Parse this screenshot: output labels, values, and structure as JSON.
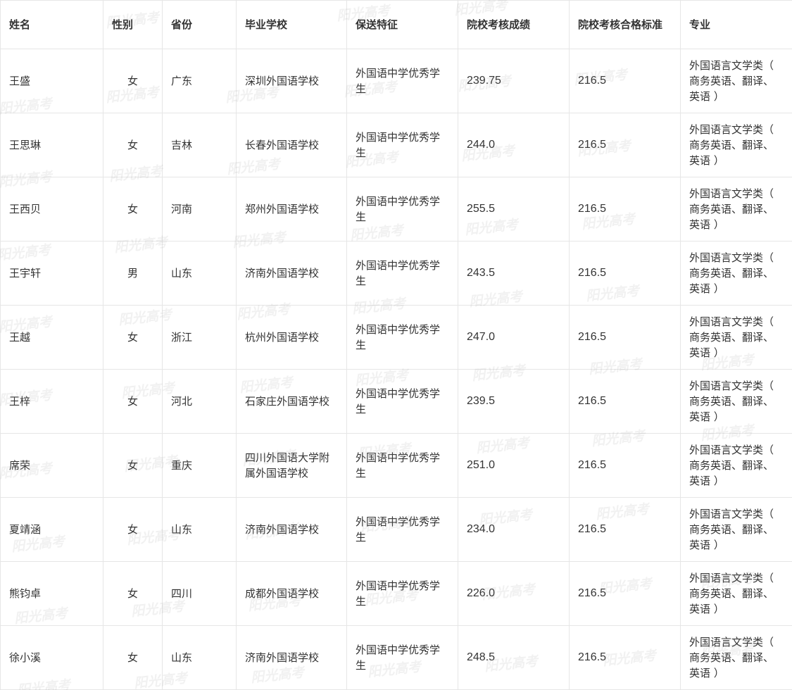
{
  "table": {
    "headers": [
      "姓名",
      "性别",
      "省份",
      "毕业学校",
      "保送特征",
      "院校考核成绩",
      "院校考核合格标准",
      "专业"
    ],
    "rows": [
      {
        "name": "王盛",
        "gender": "女",
        "province": "广东",
        "school": "深圳外国语学校",
        "feature": "外国语中学优秀学生",
        "score": "239.75",
        "standard": "216.5",
        "major": "外国语言文学类（ 商务英语、翻译、英语 ）"
      },
      {
        "name": "王思琳",
        "gender": "女",
        "province": "吉林",
        "school": "长春外国语学校",
        "feature": "外国语中学优秀学生",
        "score": "244.0",
        "standard": "216.5",
        "major": "外国语言文学类（ 商务英语、翻译、英语 ）"
      },
      {
        "name": "王西贝",
        "gender": "女",
        "province": "河南",
        "school": "郑州外国语学校",
        "feature": "外国语中学优秀学生",
        "score": "255.5",
        "standard": "216.5",
        "major": "外国语言文学类（ 商务英语、翻译、英语 ）"
      },
      {
        "name": "王宇轩",
        "gender": "男",
        "province": "山东",
        "school": "济南外国语学校",
        "feature": "外国语中学优秀学生",
        "score": "243.5",
        "standard": "216.5",
        "major": "外国语言文学类（ 商务英语、翻译、英语 ）"
      },
      {
        "name": "王越",
        "gender": "女",
        "province": "浙江",
        "school": "杭州外国语学校",
        "feature": "外国语中学优秀学生",
        "score": "247.0",
        "standard": "216.5",
        "major": "外国语言文学类（ 商务英语、翻译、英语 ）"
      },
      {
        "name": "王梓",
        "gender": "女",
        "province": "河北",
        "school": "石家庄外国语学校",
        "feature": "外国语中学优秀学生",
        "score": "239.5",
        "standard": "216.5",
        "major": "外国语言文学类（ 商务英语、翻译、英语 ）"
      },
      {
        "name": "席荣",
        "gender": "女",
        "province": "重庆",
        "school": "四川外国语大学附属外国语学校",
        "feature": "外国语中学优秀学生",
        "score": "251.0",
        "standard": "216.5",
        "major": "外国语言文学类（ 商务英语、翻译、英语 ）"
      },
      {
        "name": "夏靖涵",
        "gender": "女",
        "province": "山东",
        "school": "济南外国语学校",
        "feature": "外国语中学优秀学生",
        "score": "234.0",
        "standard": "216.5",
        "major": "外国语言文学类（ 商务英语、翻译、英语 ）"
      },
      {
        "name": "熊钧卓",
        "gender": "女",
        "province": "四川",
        "school": "成都外国语学校",
        "feature": "外国语中学优秀学生",
        "score": "226.0",
        "standard": "216.5",
        "major": "外国语言文学类（ 商务英语、翻译、英语 ）"
      },
      {
        "name": "徐小溪",
        "gender": "女",
        "province": "山东",
        "school": "济南外国语学校",
        "feature": "外国语中学优秀学生",
        "score": "248.5",
        "standard": "216.5",
        "major": "外国语言文学类（ 商务英语、翻译、英语 ）"
      }
    ]
  },
  "watermark": {
    "text": "阳光高考",
    "color": "#969696"
  },
  "colors": {
    "border": "#e6e6e6",
    "text": "#333333",
    "background": "#ffffff"
  }
}
